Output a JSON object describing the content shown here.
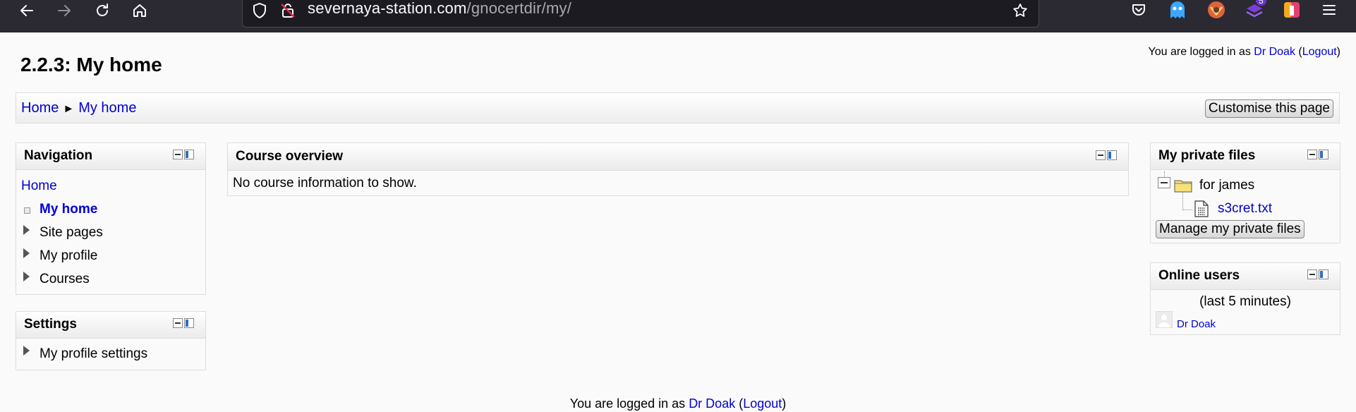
{
  "browser": {
    "url_domain": "severnaya-station.com",
    "url_path": "/gnocertdir/my/",
    "extension_badge": "5"
  },
  "page": {
    "title": "2.2.3: My home",
    "login_prefix": "You are logged in as ",
    "user_name": "Dr Doak",
    "open_paren": "(",
    "logout_label": "Logout",
    "close_paren": ")"
  },
  "breadcrumb": {
    "home": "Home",
    "separator": "►",
    "current": "My home"
  },
  "customise_button": "Customise this page",
  "navigation_block": {
    "title": "Navigation",
    "home": "Home",
    "items": [
      "My home",
      "Site pages",
      "My profile",
      "Courses"
    ]
  },
  "settings_block": {
    "title": "Settings",
    "items": [
      "My profile settings"
    ]
  },
  "course_overview": {
    "title": "Course overview",
    "message": "No course information to show."
  },
  "private_files": {
    "title": "My private files",
    "folder": "for james",
    "file": "s3cret.txt",
    "manage_button": "Manage my private files"
  },
  "online_users": {
    "title": "Online users",
    "period": "(last 5 minutes)",
    "users": [
      "Dr Doak"
    ]
  }
}
